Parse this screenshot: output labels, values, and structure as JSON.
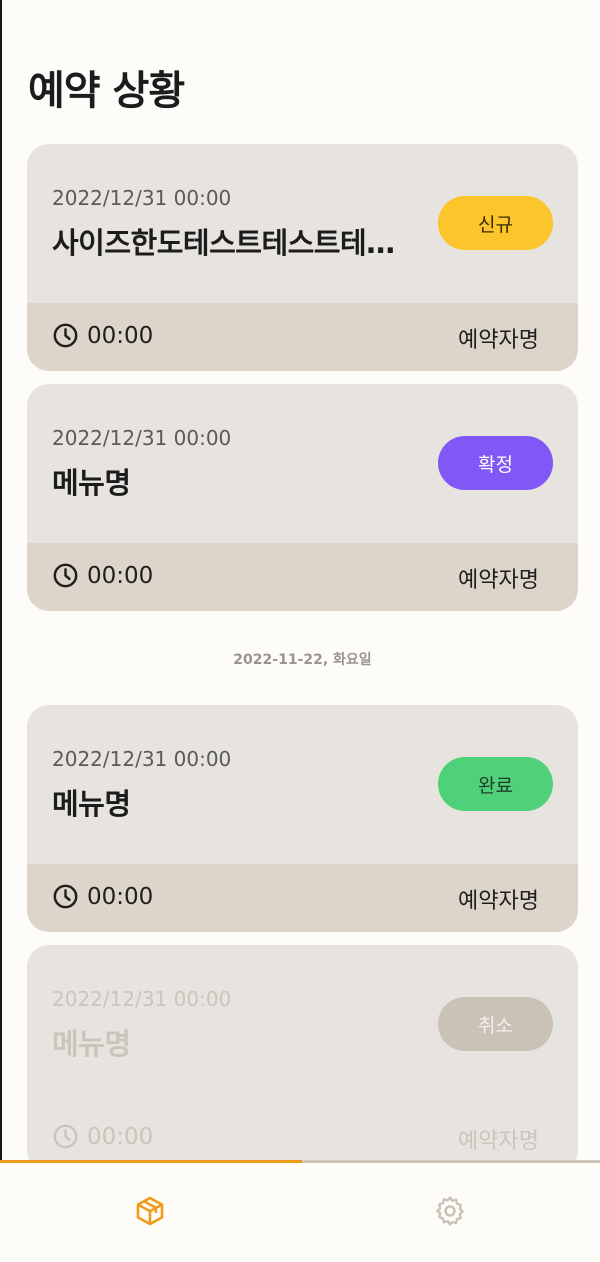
{
  "page": {
    "title": "예약 상황"
  },
  "colors": {
    "accent": "#ef9a1b",
    "badge_new": "#fbc52b",
    "badge_confirmed": "#8058f6",
    "badge_done": "#4fd17a",
    "badge_cancel": "#cbc2b7"
  },
  "reservations_today": [
    {
      "datetime": "2022/12/31 00:00",
      "menu": "사이즈한도테스트테스트테스트",
      "status": "신규",
      "time": "00:00",
      "customer": "예약자명"
    },
    {
      "datetime": "2022/12/31 00:00",
      "menu": "메뉴명",
      "status": "확정",
      "time": "00:00",
      "customer": "예약자명"
    }
  ],
  "date_separator": "2022-11-22, 화요일",
  "reservations_later": [
    {
      "datetime": "2022/12/31 00:00",
      "menu": "메뉴명",
      "status": "완료",
      "time": "00:00",
      "customer": "예약자명"
    },
    {
      "datetime": "2022/12/31 00:00",
      "menu": "메뉴명",
      "status": "취소",
      "time": "00:00",
      "customer": "예약자명"
    }
  ],
  "tabbar": {
    "items": [
      {
        "icon": "box-icon",
        "active": true
      },
      {
        "icon": "gear-icon",
        "active": false
      }
    ]
  }
}
